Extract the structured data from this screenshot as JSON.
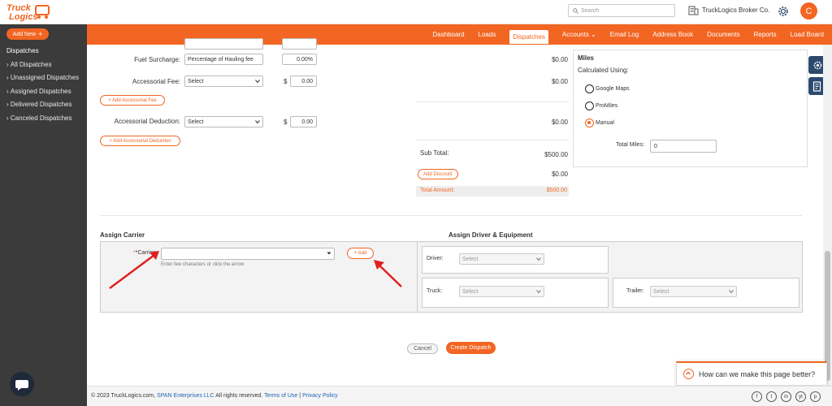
{
  "app": {
    "logo_line1": "Truck",
    "logo_line2": "Logics",
    "search_placeholder": "Search",
    "company": "TruckLogics Broker Co.",
    "avatar_initial": "C",
    "brand_color": "#f26522"
  },
  "nav": {
    "items": [
      "Dashboard",
      "Loads",
      "Dispatches",
      "Accounts",
      "Email Log",
      "Address Book",
      "Documents",
      "Reports",
      "Load Board"
    ],
    "active": "Dispatches"
  },
  "sidebar": {
    "add_new": "Add New",
    "heading": "Dispatches",
    "items": [
      "All Dispatches",
      "Unassigned Dispatches",
      "Assigned Dispatches",
      "Delivered Dispatches",
      "Canceled Dispatches"
    ]
  },
  "charges": {
    "fuel_label": "Fuel Surcharge:",
    "fuel_type": "Percentage of Hauling fee",
    "fuel_value": "0.00",
    "fuel_unit": "%",
    "fuel_amount": "$0.00",
    "accessorial_fee_label": "Accessorial Fee:",
    "accessorial_fee_select": "Select",
    "accessorial_fee_dollar": "$",
    "accessorial_fee_value": "0.00",
    "accessorial_fee_amount": "$0.00",
    "add_accessorial_fee": "+ Add Accessorial Fee",
    "accessorial_deduction_label": "Accessorial Deduction:",
    "accessorial_deduction_select": "Select",
    "accessorial_deduction_dollar": "$",
    "accessorial_deduction_value": "0.00",
    "accessorial_deduction_amount": "$0.00",
    "add_accessorial_deduction": "+ Add Accessorial Deduction",
    "subtotal_label": "Sub Total:",
    "subtotal_value": "$500.00",
    "add_discount": "Add Discount",
    "discount_value": "$0.00",
    "total_label": "Total Amount:",
    "total_value": "$500.00"
  },
  "miles": {
    "title": "Miles",
    "calculated_using": "Calculated Using:",
    "options": [
      "Google Maps",
      "ProMiles",
      "Manual"
    ],
    "selected": "Manual",
    "total_miles_label": "Total Miles:",
    "total_miles_value": "0"
  },
  "assign": {
    "carrier_heading": "Assign Carrier",
    "driver_heading": "Assign Driver & Equipment",
    "carrier_label": "*Carrier:",
    "carrier_hint": "Enter few characters or click the arrow",
    "add_label": "+ Add",
    "driver_label": "Driver:",
    "truck_label": "Truck:",
    "trailer_label": "Trailer:",
    "select_placeholder": "Select"
  },
  "actions": {
    "cancel": "Cancel",
    "create": "Create Dispatch"
  },
  "footer": {
    "copyright": "© 2023 TruckLogics.com,",
    "company_link": "SPAN Enterprises LLC",
    "rights": "All rights reserved.",
    "terms": "Terms of Use",
    "separator": "|",
    "privacy": "Privacy Policy",
    "social": [
      "f",
      "t",
      "in",
      "yt",
      "p"
    ]
  },
  "feedback": {
    "text": "How can we make this page better?"
  }
}
